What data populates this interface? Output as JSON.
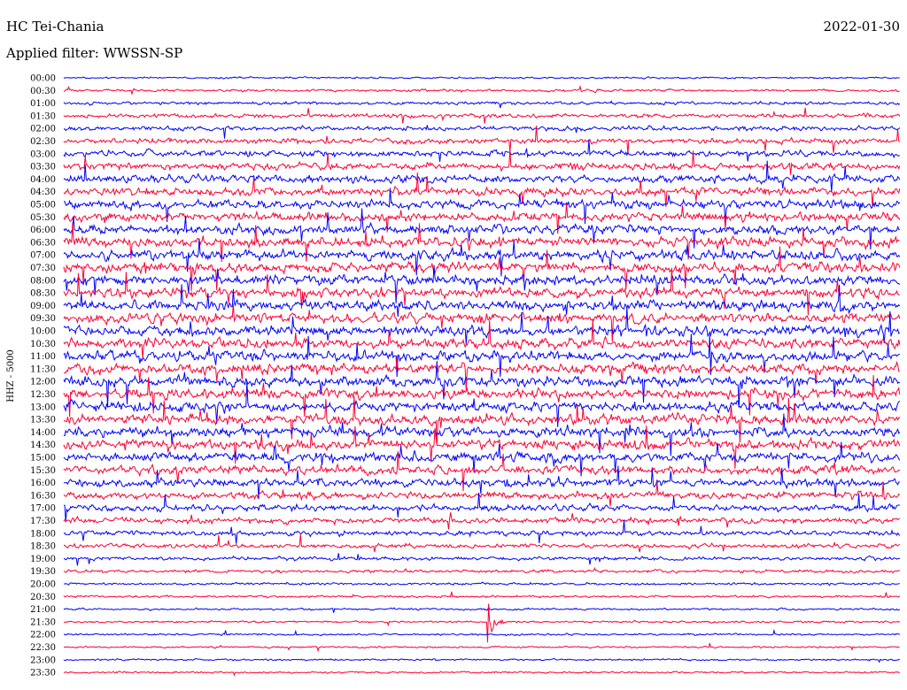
{
  "header": {
    "station": "HC Tei-Chania",
    "date": "2022-01-30",
    "filter": "Applied filter: WWSSN-SP"
  },
  "chart_data": {
    "type": "line",
    "title": "HC Tei-Chania",
    "ylabel": "HHZ - 5000",
    "row_labels": [
      "00:00",
      "00:30",
      "01:00",
      "01:30",
      "02:00",
      "02:30",
      "03:00",
      "03:30",
      "04:00",
      "04:30",
      "05:00",
      "05:30",
      "06:00",
      "06:30",
      "07:00",
      "07:30",
      "08:00",
      "08:30",
      "09:00",
      "09:30",
      "10:00",
      "10:30",
      "11:00",
      "11:30",
      "12:00",
      "12:30",
      "13:00",
      "13:30",
      "14:00",
      "14:30",
      "15:00",
      "15:30",
      "16:00",
      "16:30",
      "17:00",
      "17:30",
      "18:00",
      "18:30",
      "19:00",
      "19:30",
      "20:00",
      "20:30",
      "21:00",
      "21:30",
      "22:00",
      "22:30",
      "23:00",
      "23:30"
    ],
    "trace_colors": [
      "#0000ff",
      "#ff0033"
    ],
    "noise_level": [
      0.25,
      0.35,
      0.45,
      0.55,
      0.65,
      0.75,
      0.85,
      0.95,
      1.05,
      1.15,
      1.2,
      1.25,
      1.3,
      1.35,
      1.4,
      1.4,
      1.4,
      1.4,
      1.4,
      1.4,
      1.4,
      1.4,
      1.4,
      1.4,
      1.4,
      1.4,
      1.4,
      1.4,
      1.4,
      1.35,
      1.3,
      1.2,
      1.1,
      1.0,
      0.9,
      0.8,
      0.7,
      0.6,
      0.5,
      0.42,
      0.35,
      0.3,
      0.28,
      0.26,
      0.26,
      0.25,
      0.25,
      0.25
    ],
    "events": [
      {
        "row": "21:30",
        "time_min": 15.2,
        "amplitude": 6,
        "duration_min": 0.6,
        "label": ""
      }
    ]
  }
}
